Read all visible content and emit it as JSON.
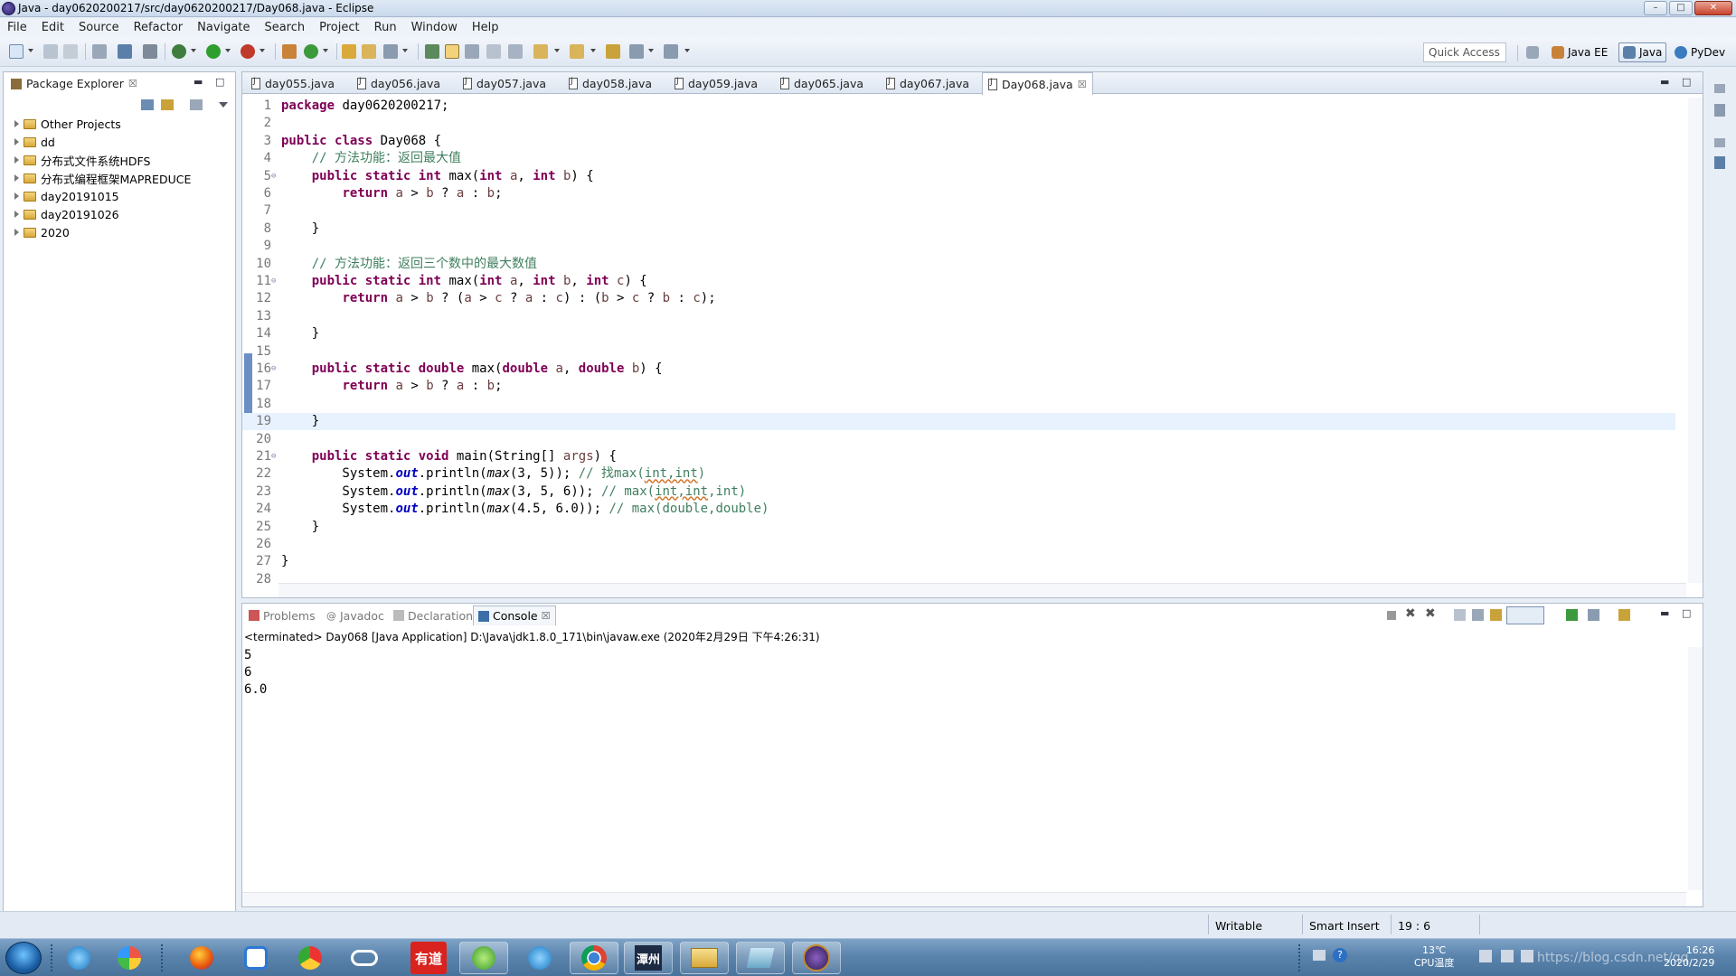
{
  "window": {
    "title": "Java - day0620200217/src/day0620200217/Day068.java - Eclipse"
  },
  "menu": [
    "File",
    "Edit",
    "Source",
    "Refactor",
    "Navigate",
    "Search",
    "Project",
    "Run",
    "Window",
    "Help"
  ],
  "toolbar": {
    "quick_access": "Quick Access",
    "perspectives": [
      {
        "label": "Java EE",
        "active": false
      },
      {
        "label": "Java",
        "active": true
      },
      {
        "label": "PyDev",
        "active": false
      }
    ]
  },
  "package_explorer": {
    "title": "Package Explorer",
    "items": [
      "Other Projects",
      "dd",
      "分布式文件系统HDFS",
      "分布式编程框架MAPREDUCE",
      "day20191015",
      "day20191026",
      "2020"
    ]
  },
  "editor": {
    "tabs": [
      {
        "label": "day055.java",
        "active": false
      },
      {
        "label": "day056.java",
        "active": false
      },
      {
        "label": "day057.java",
        "active": false
      },
      {
        "label": "day058.java",
        "active": false
      },
      {
        "label": "day059.java",
        "active": false
      },
      {
        "label": "day065.java",
        "active": false
      },
      {
        "label": "day067.java",
        "active": false
      },
      {
        "label": "Day068.java",
        "active": true
      }
    ],
    "current_line": 19,
    "lines": [
      {
        "n": "1",
        "text": "package day0620200217;"
      },
      {
        "n": "2",
        "text": ""
      },
      {
        "n": "3",
        "text": "public class Day068 {"
      },
      {
        "n": "4",
        "text": "    // 方法功能：返回最大值"
      },
      {
        "n": "5",
        "text": "    public static int max(int a, int b) {"
      },
      {
        "n": "6",
        "text": "        return a > b ? a : b;"
      },
      {
        "n": "7",
        "text": ""
      },
      {
        "n": "8",
        "text": "    }"
      },
      {
        "n": "9",
        "text": ""
      },
      {
        "n": "10",
        "text": "    // 方法功能：返回三个数中的最大数值"
      },
      {
        "n": "11",
        "text": "    public static int max(int a, int b, int c) {"
      },
      {
        "n": "12",
        "text": "        return a > b ? (a > c ? a : c) : (b > c ? b : c);"
      },
      {
        "n": "13",
        "text": ""
      },
      {
        "n": "14",
        "text": "    }"
      },
      {
        "n": "15",
        "text": ""
      },
      {
        "n": "16",
        "text": "    public static double max(double a, double b) {"
      },
      {
        "n": "17",
        "text": "        return a > b ? a : b;"
      },
      {
        "n": "18",
        "text": ""
      },
      {
        "n": "19",
        "text": "    }"
      },
      {
        "n": "20",
        "text": ""
      },
      {
        "n": "21",
        "text": "    public static void main(String[] args) {"
      },
      {
        "n": "22",
        "text": "        System.out.println(max(3, 5)); // 找max(int,int)"
      },
      {
        "n": "23",
        "text": "        System.out.println(max(3, 5, 6)); // max(int,int,int)"
      },
      {
        "n": "24",
        "text": "        System.out.println(max(4.5, 6.0)); // max(double,double)"
      },
      {
        "n": "25",
        "text": "    }"
      },
      {
        "n": "26",
        "text": ""
      },
      {
        "n": "27",
        "text": "}"
      },
      {
        "n": "28",
        "text": ""
      }
    ]
  },
  "console": {
    "tabs": [
      {
        "label": "Problems",
        "active": false
      },
      {
        "label": "Javadoc",
        "active": false
      },
      {
        "label": "Declaration",
        "active": false
      },
      {
        "label": "Console",
        "active": true
      }
    ],
    "header": "<terminated> Day068 [Java Application] D:\\Java\\jdk1.8.0_171\\bin\\javaw.exe (2020年2月29日 下午4:26:31)",
    "output": [
      "5",
      "6",
      "6.0"
    ]
  },
  "status": {
    "writable": "Writable",
    "insert_mode": "Smart Insert",
    "position": "19 : 6"
  },
  "taskbar": {
    "apps": [
      "ie-icon",
      "app-icon",
      "firefox-icon",
      "baidu-icon",
      "chrome-green-icon",
      "cloud-icon",
      "youdao-icon",
      "refresh-app-icon",
      "ie-icon-2",
      "chrome-icon",
      "weizhou-icon",
      "explorer-folder-icon",
      "notepad-icon",
      "java-ee-icon"
    ],
    "youdao_label": "有道",
    "weizhou_label": "潭州",
    "temperature": "13℃",
    "temperature_label": "CPU温度",
    "clock_time": "16:26",
    "clock_date": "2020/2/29",
    "watermark": "https://blog.csdn.net/qq"
  }
}
